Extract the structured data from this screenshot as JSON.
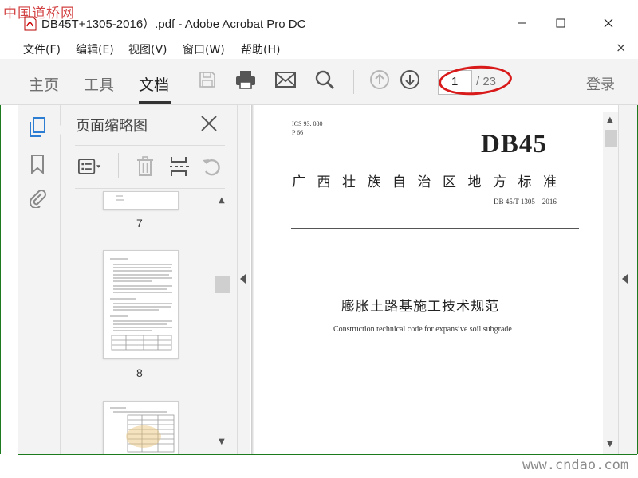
{
  "watermark_top": "中国道桥网",
  "window": {
    "title": "DB45T+1305-2016）.pdf - Adobe Acrobat Pro DC"
  },
  "menu": {
    "items": [
      "文件(F)",
      "编辑(E)",
      "视图(V)",
      "窗口(W)",
      "帮助(H)"
    ],
    "close": "×"
  },
  "toolbar": {
    "tabs": [
      "主页",
      "工具",
      "文档"
    ],
    "active_tab": "文档",
    "page_current": "1",
    "page_total": "/ 23",
    "login": "登录"
  },
  "panel": {
    "title": "页面缩略图",
    "thumbnails": [
      {
        "label": "7"
      },
      {
        "label": "8"
      }
    ]
  },
  "document": {
    "ics": "ICS 93. 080",
    "p_code": "P 66",
    "code": "DB45",
    "region_title": "广西壮族自治区地方标准",
    "std_no": "DB 45/T 1305—2016",
    "title_cn": "膨胀土路基施工技术规范",
    "title_en": "Construction technical code for expansive soil subgrade"
  },
  "watermark_bottom": "www.cndao.com",
  "colors": {
    "highlight_oval": "#d81a1a",
    "frame": "#1e7a1e",
    "rail_active_icon": "#2d7dd2"
  }
}
